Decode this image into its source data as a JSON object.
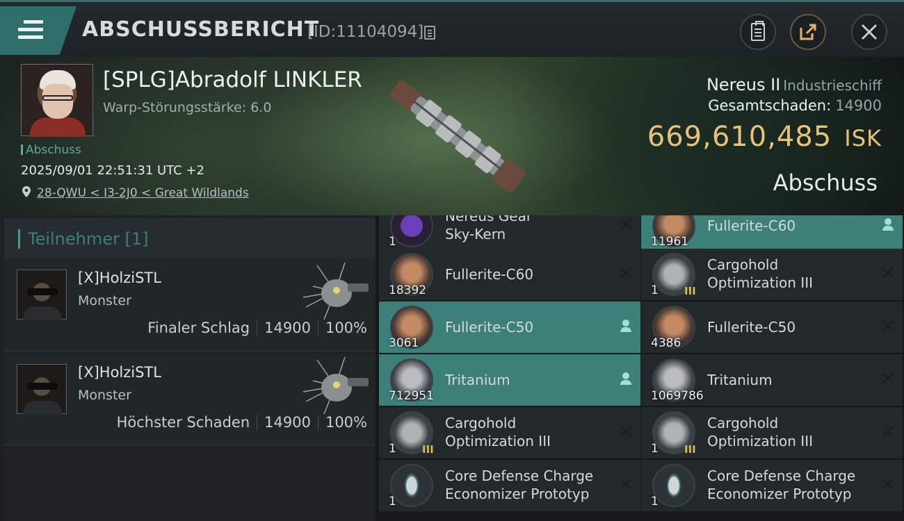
{
  "header": {
    "title": "ABSCHUSSBERICHT",
    "report_id": "[ID:11104094]"
  },
  "victim": {
    "name": "[SPLG]Abradolf LINKLER",
    "warp_strength": "Warp-Störungsstärke: 6.0",
    "tag": "Abschuss",
    "datetime": "2025/09/01 22:51:31 UTC +2",
    "location": "28-QWU < I3-2J0 < Great Wildlands",
    "ship_name": "Nereus II",
    "ship_class": "Industrieschiff",
    "damage_label": "Gesamtschaden:",
    "damage_value": "14900",
    "isk_value": "669,610,485",
    "isk_unit": "ISK",
    "verdict": "Abschuss"
  },
  "participants": {
    "header": "Teilnehmer [1]",
    "rows": [
      {
        "name": "[X]HolziSTL",
        "corp": "Monster",
        "label": "Finaler Schlag",
        "damage": "14900",
        "percent": "100%"
      },
      {
        "name": "[X]HolziSTL",
        "corp": "Monster",
        "label": "Höchster Schaden",
        "damage": "14900",
        "percent": "100%"
      }
    ]
  },
  "items": [
    {
      "line1": "Nereus Gear",
      "line2": "Sky-Kern",
      "qty": "1",
      "mark": "x",
      "icon": "core-icon",
      "highlight": false
    },
    {
      "line1": "Fullerite-C60",
      "line2": "",
      "qty": "11961",
      "mark": "person",
      "icon": "gas-icon",
      "highlight": true
    },
    {
      "line1": "Fullerite-C60",
      "line2": "",
      "qty": "18392",
      "mark": "x",
      "icon": "gas-icon",
      "highlight": false
    },
    {
      "line1": "Cargohold",
      "line2": "Optimization III",
      "qty": "1",
      "mark": "x",
      "icon": "cargo-rig-icon",
      "tier": "III",
      "highlight": false
    },
    {
      "line1": "Fullerite-C50",
      "line2": "",
      "qty": "3061",
      "mark": "person",
      "icon": "gas-icon",
      "highlight": true
    },
    {
      "line1": "Fullerite-C50",
      "line2": "",
      "qty": "4386",
      "mark": "x",
      "icon": "gas-icon",
      "highlight": false
    },
    {
      "line1": "Tritanium",
      "line2": "",
      "qty": "712951",
      "mark": "person",
      "icon": "ore-icon",
      "highlight": true
    },
    {
      "line1": "Tritanium",
      "line2": "",
      "qty": "1069786",
      "mark": "x",
      "icon": "ore-icon",
      "highlight": false
    },
    {
      "line1": "Cargohold",
      "line2": "Optimization III",
      "qty": "1",
      "mark": "x",
      "icon": "cargo-rig-icon",
      "tier": "III",
      "highlight": false
    },
    {
      "line1": "Cargohold",
      "line2": "Optimization III",
      "qty": "1",
      "mark": "x",
      "icon": "cargo-rig-icon",
      "tier": "III",
      "highlight": false
    },
    {
      "line1": "Core Defense Charge",
      "line2": "Economizer Prototyp",
      "qty": "1",
      "mark": "x",
      "icon": "shield-rig-icon",
      "highlight": false
    },
    {
      "line1": "Core Defense Charge",
      "line2": "Economizer Prototyp",
      "qty": "1",
      "mark": "x",
      "icon": "shield-rig-icon",
      "highlight": false
    }
  ],
  "colors": {
    "accent": "#3d7f79",
    "isk": "#e9c27a",
    "background": "#15191c"
  }
}
